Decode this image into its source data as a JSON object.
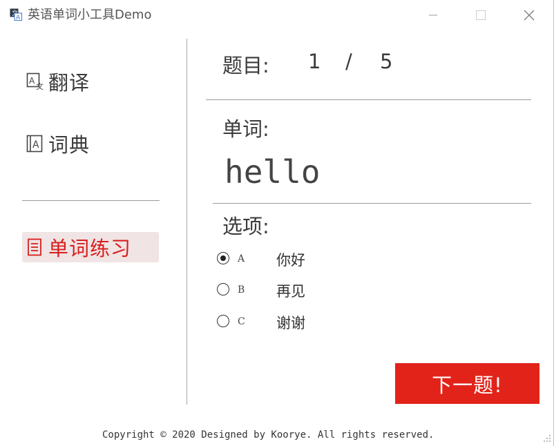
{
  "window": {
    "title": "英语单词小工具Demo",
    "icons": {
      "app": "translate-app-icon",
      "minimize": "minimize-icon",
      "maximize": "maximize-icon",
      "close": "close-icon"
    }
  },
  "sidebar": {
    "items": [
      {
        "label": "翻译",
        "icon": "translate-icon",
        "active": false
      },
      {
        "label": "词典",
        "icon": "dictionary-icon",
        "active": false
      },
      {
        "label": "单词练习",
        "icon": "list-icon",
        "active": true
      }
    ]
  },
  "quiz": {
    "question_label": "题目:",
    "current": "1",
    "separator": "/",
    "total": "5",
    "word_label": "单词:",
    "word": "hello",
    "options_label": "选项:",
    "options": [
      {
        "letter": "A",
        "text": "你好",
        "selected": true
      },
      {
        "letter": "B",
        "text": "再见",
        "selected": false
      },
      {
        "letter": "C",
        "text": "谢谢",
        "selected": false
      }
    ],
    "next_button": "下一题!"
  },
  "footer": {
    "text": "Copyright © 2020 Designed by Koorye. All rights reserved."
  },
  "colors": {
    "accent": "#e2231a",
    "active_text": "#d81e1e",
    "active_bg": "#f0e4e4"
  }
}
